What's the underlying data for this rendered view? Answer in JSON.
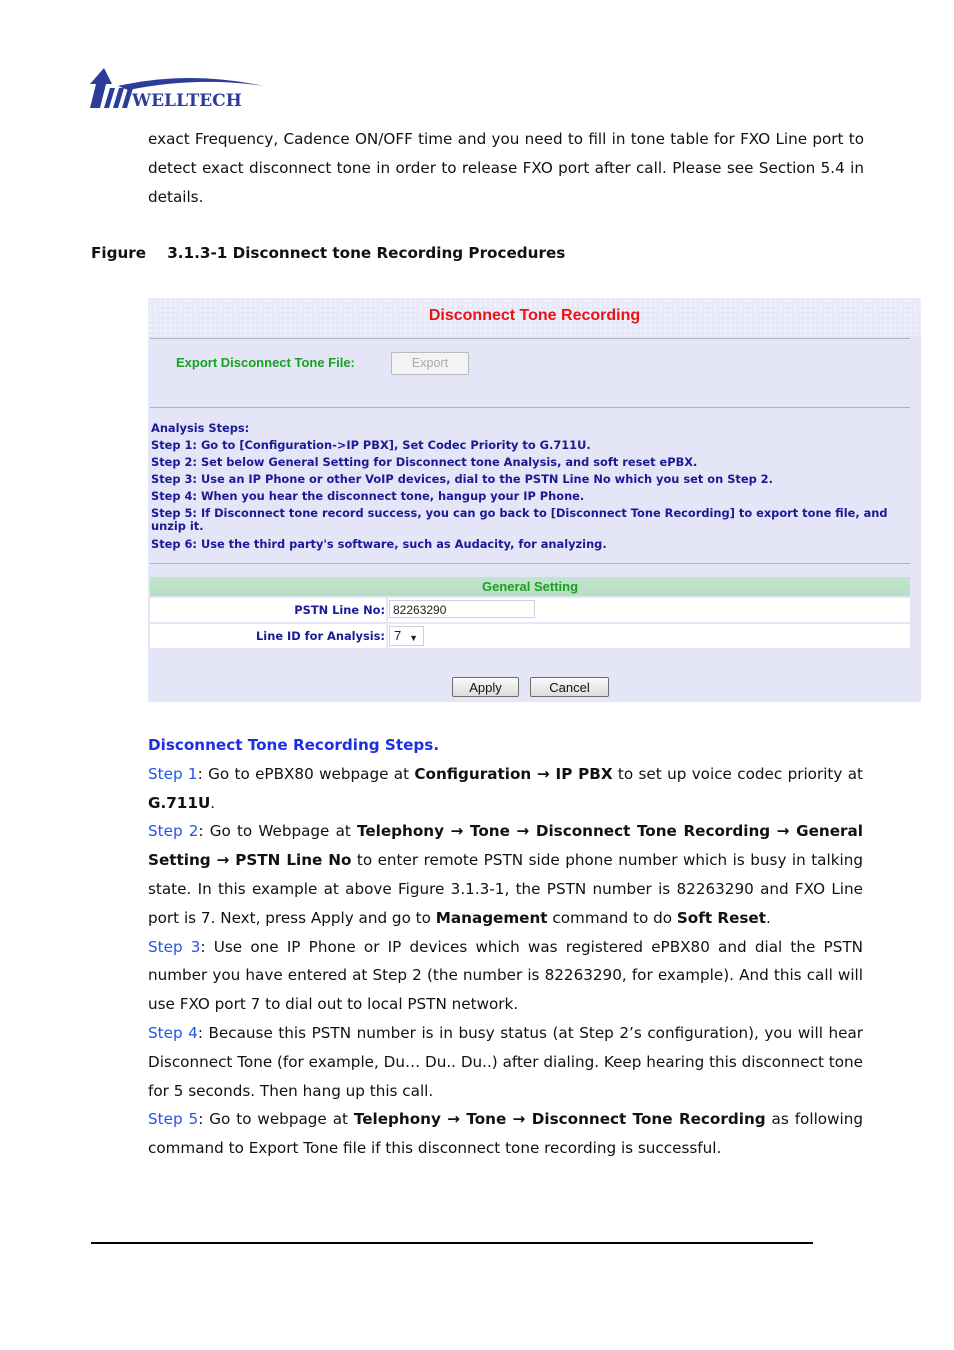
{
  "logo": {
    "text": "WELLTECH",
    "color": "#2b3d99"
  },
  "intro": {
    "text": "exact Frequency, Cadence ON/OFF time and you need to fill in tone table for FXO Line port to detect exact disconnect tone in order to release FXO port after call. Please see Section 5.4 in details."
  },
  "figure": {
    "caption": "Figure    3.1.3-1 Disconnect tone Recording Procedures"
  },
  "panel": {
    "title": "Disconnect Tone Recording",
    "export_label": "Export Disconnect Tone File:",
    "export_button": "Export",
    "analysis_heading": "Analysis Steps:",
    "analysis_steps": [
      "Step 1: Go to [Configuration->IP PBX], Set Codec Priority to G.711U.",
      "Step 2: Set below General Setting for Disconnect tone Analysis, and soft reset ePBX.",
      "Step 3: Use an IP Phone or other VoIP devices, dial to the PSTN Line No which you set on Step 2.",
      "Step 4: When you hear the disconnect tone, hangup your IP Phone.",
      "Step 5: If Disconnect tone record success, you can go back to [Disconnect Tone Recording] to export tone file, and unzip it.",
      "Step 6: Use the third party's software, such as Audacity, for analyzing."
    ],
    "general_setting": {
      "heading": "General Setting",
      "pstn_label": "PSTN Line No:",
      "pstn_value": "82263290",
      "line_id_label": "Line ID for Analysis:",
      "line_id_value": "7"
    },
    "apply_button": "Apply",
    "cancel_button": "Cancel",
    "colors": {
      "title": "#ee1111",
      "label_green": "#16a11e",
      "label_blue": "#1a1a96",
      "background": "#e4e5f7"
    }
  },
  "steps": {
    "heading": "Disconnect Tone Recording Steps.",
    "items": [
      {
        "label": "Step 1",
        "parts": [
          ": Go to ePBX80 webpage at ",
          "Configuration → IP PBX",
          " to set up voice codec priority at ",
          "G.711U",
          "."
        ]
      },
      {
        "label": "Step 2",
        "parts": [
          ": Go to Webpage at ",
          "Telephony → Tone → Disconnect Tone Recording → General Setting → PSTN Line No",
          " to enter remote PSTN side phone number which is busy in talking state. In this example at above Figure 3.1.3-1, the PSTN number is 82263290 and FXO Line port is 7. Next, press Apply and go to ",
          "Management",
          " command to do ",
          "Soft Reset",
          "."
        ]
      },
      {
        "label": "Step 3",
        "parts": [
          ": Use one IP Phone or IP devices which was registered ePBX80 and dial the PSTN number you have entered at Step 2 (the number is 82263290, for example). And this call will use FXO port 7 to dial out to local PSTN network."
        ]
      },
      {
        "label": "Step 4",
        "parts": [
          ": Because this PSTN number is in busy status (at Step 2’s configuration), you will hear Disconnect Tone (for example, Du… Du.. Du..) after dialing. Keep hearing this disconnect tone for 5 seconds. Then hang up this call."
        ]
      },
      {
        "label": "Step 5",
        "parts": [
          ": Go to webpage at ",
          "Telephony → Tone → Disconnect Tone Recording",
          " as following command to Export Tone file if this disconnect tone recording is successful."
        ]
      }
    ]
  }
}
